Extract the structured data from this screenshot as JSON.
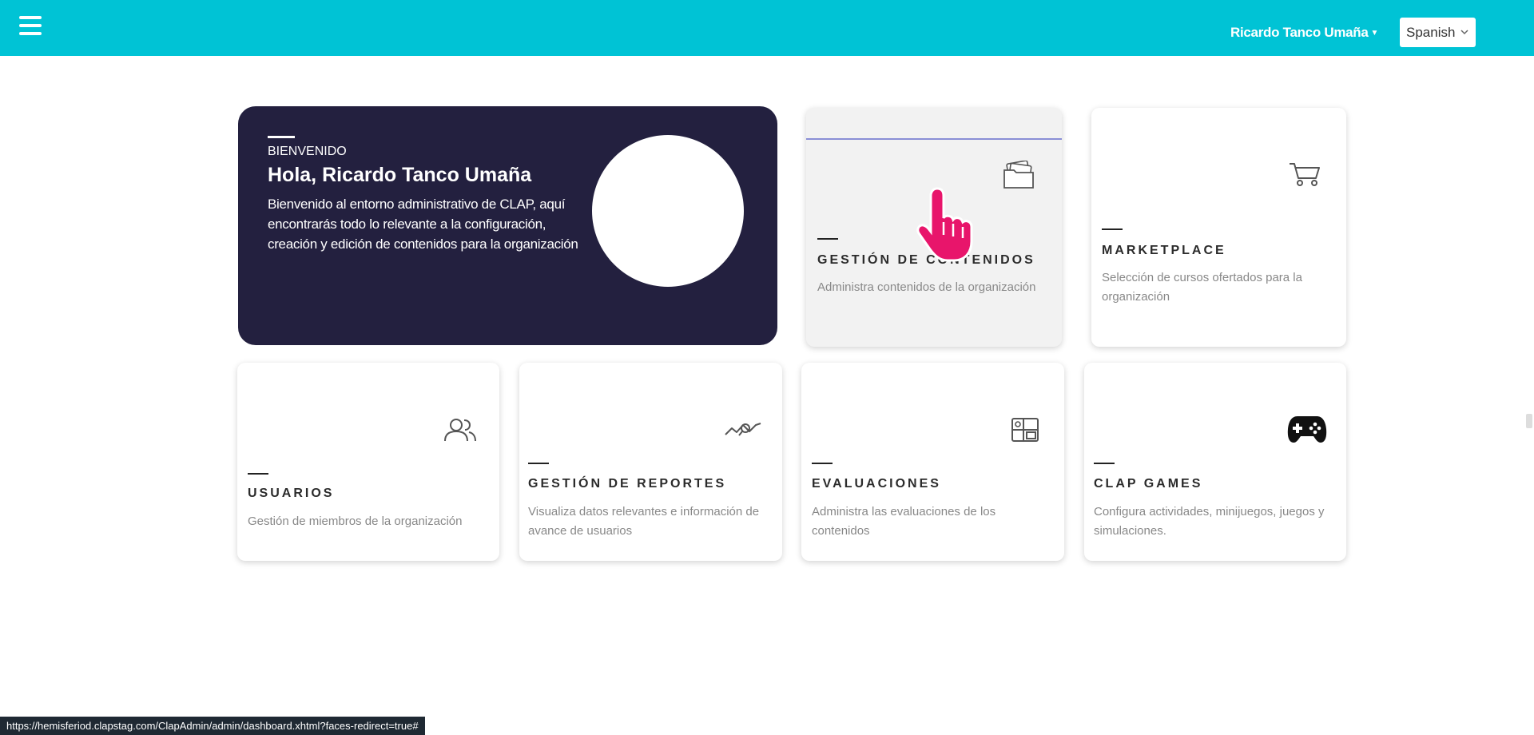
{
  "header": {
    "user_name": "Ricardo Tanco Umaña",
    "language": "Spanish",
    "accent_color": "#00c3d5"
  },
  "welcome": {
    "kicker": "BIENVENIDO",
    "greeting": "Hola, Ricardo Tanco Umaña",
    "message": "Bienvenido al entorno administrativo de CLAP, aquí encontrarás todo lo relevante a la configuración, creación y edición de contenidos para la organización",
    "background_color": "#23203f"
  },
  "modules": [
    {
      "title": "GESTIÓN DE CONTENIDOS",
      "description": "Administra contenidos de la organización",
      "icon": "folder-images-icon"
    },
    {
      "title": "MARKETPLACE",
      "description": "Selección de cursos ofertados para la organización",
      "icon": "shopping-cart-icon"
    },
    {
      "title": "USUARIOS",
      "description": "Gestión de miembros de la organización",
      "icon": "users-icon"
    },
    {
      "title": "GESTIÓN DE REPORTES",
      "description": "Visualiza datos relevantes e información de avance de usuarios",
      "icon": "analytics-icon"
    },
    {
      "title": "EVALUACIONES",
      "description": "Administra las evaluaciones de los contenidos",
      "icon": "layout-icon"
    },
    {
      "title": "CLAP GAMES",
      "description": "Configura actividades, minijuegos, juegos y simulaciones.",
      "icon": "gamepad-icon"
    }
  ],
  "status_url": "https://hemisferiod.clapstag.com/ClapAdmin/admin/dashboard.xhtml?faces-redirect=true#"
}
